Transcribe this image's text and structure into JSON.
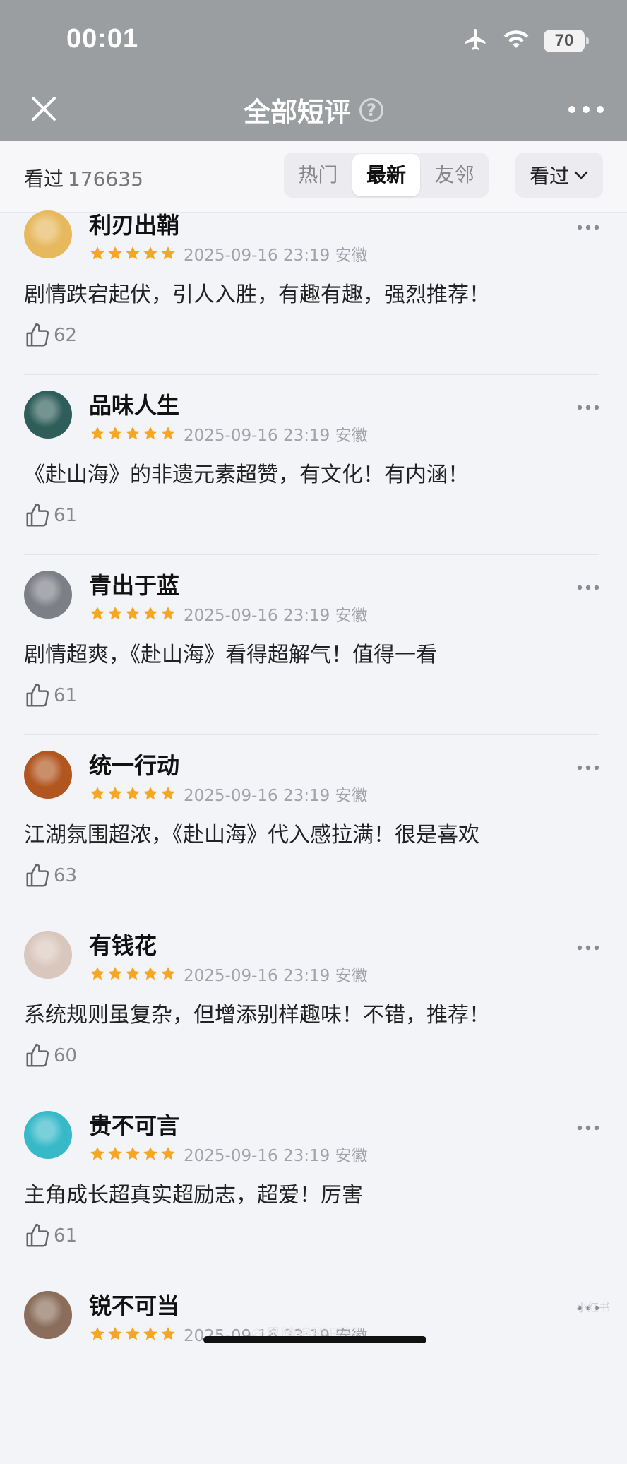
{
  "status_bar": {
    "time": "00:01",
    "battery": "70",
    "airplane_icon": "airplane-icon",
    "wifi_icon": "wifi-icon"
  },
  "nav": {
    "title": "全部短评",
    "help": "?",
    "close_icon": "close-icon",
    "more_icon": "more-icon"
  },
  "filter": {
    "seen_label": "看过",
    "seen_count": "176635",
    "tabs": [
      "热门",
      "最新",
      "友邻"
    ],
    "active_tab": "最新",
    "sort_label": "看过"
  },
  "colors": {
    "star": "#f5a623",
    "nav_bg": "#9b9ea0",
    "page_bg": "#f3f4f8"
  },
  "reviews": [
    {
      "name": "利刃出鞘",
      "rating": 5,
      "date": "2025-09-16 23:19 安徽",
      "text": "剧情跌宕起伏，引人入胜，有趣有趣，强烈推荐！",
      "likes": "62",
      "avatar_color": "#e7b95f"
    },
    {
      "name": "品味人生",
      "rating": 5,
      "date": "2025-09-16 23:19 安徽",
      "text": "《赴山海》的非遗元素超赞，有文化！有内涵！",
      "likes": "61",
      "avatar_color": "#2f5e5a"
    },
    {
      "name": "青出于蓝",
      "rating": 5,
      "date": "2025-09-16 23:19 安徽",
      "text": "剧情超爽，《赴山海》看得超解气！值得一看",
      "likes": "61",
      "avatar_color": "#7d7f86"
    },
    {
      "name": "统一行动",
      "rating": 5,
      "date": "2025-09-16 23:19 安徽",
      "text": "江湖氛围超浓，《赴山海》代入感拉满！很是喜欢",
      "likes": "63",
      "avatar_color": "#b1561f"
    },
    {
      "name": "有钱花",
      "rating": 5,
      "date": "2025-09-16 23:19 安徽",
      "text": "系统规则虽复杂，但增添别样趣味！不错，推荐！",
      "likes": "60",
      "avatar_color": "#d9c7bd"
    },
    {
      "name": "贵不可言",
      "rating": 5,
      "date": "2025-09-16 23:19 安徽",
      "text": "主角成长超真实超励志，超爱！厉害",
      "likes": "61",
      "avatar_color": "#37b9c8"
    },
    {
      "name": "锐不可当",
      "rating": 5,
      "date": "2025-09-16 23:19 安徽",
      "text": "",
      "likes": "",
      "avatar_color": "#8a6d5a"
    }
  ],
  "watermark": "@星晴追剧日记",
  "corner_mark": "小红书"
}
